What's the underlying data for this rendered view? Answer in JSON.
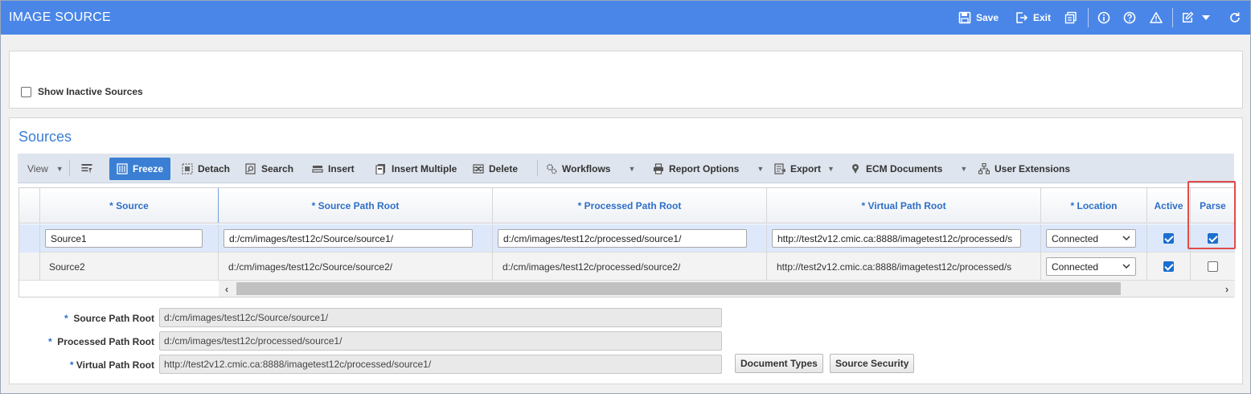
{
  "window": {
    "title": "IMAGE SOURCE"
  },
  "header_actions": {
    "save": "Save",
    "exit": "Exit"
  },
  "filters": {
    "show_inactive_label": "Show Inactive Sources",
    "show_inactive_checked": false
  },
  "section": {
    "title": "Sources"
  },
  "toolbar": {
    "view": "View",
    "freeze": "Freeze",
    "detach": "Detach",
    "search": "Search",
    "insert": "Insert",
    "insert_multiple": "Insert Multiple",
    "delete": "Delete",
    "workflows": "Workflows",
    "report_options": "Report Options",
    "export": "Export",
    "ecm_documents": "ECM Documents",
    "user_extensions": "User Extensions"
  },
  "grid": {
    "columns": [
      "* Source",
      "* Source Path Root",
      "*  Processed Path Root",
      "* Virtual Path Root",
      "* Location",
      "Active",
      "Parse"
    ],
    "rows": [
      {
        "source": "Source1",
        "source_path_root": "d:/cm/images/test12c/Source/source1/",
        "processed_path_root": "d:/cm/images/test12c/processed/source1/",
        "virtual_path_root": "http://test2v12.cmic.ca:8888/imagetest12c/processed/s",
        "location": "Connected",
        "active": true,
        "parse": true
      },
      {
        "source": "Source2",
        "source_path_root": "d:/cm/images/test12c/Source/source2/",
        "processed_path_root": "d:/cm/images/test12c/processed/source2/",
        "virtual_path_root": "http://test2v12.cmic.ca:8888/imagetest12c/processed/s",
        "location": "Connected",
        "active": true,
        "parse": false
      }
    ]
  },
  "detail": {
    "source_path_root_label": "Source Path Root",
    "source_path_root_value": "d:/cm/images/test12c/Source/source1/",
    "processed_path_root_label": "Processed Path Root",
    "processed_path_root_value": "d:/cm/images/test12c/processed/source1/",
    "virtual_path_root_label": "Virtual Path Root",
    "virtual_path_root_value": "http://test2v12.cmic.ca:8888/imagetest12c/processed/source1/",
    "document_types_button": "Document Types",
    "source_security_button": "Source Security"
  },
  "colors": {
    "header_blue": "#4a86e8",
    "accent_blue": "#3a7fd4",
    "highlight_red": "#e14b4b"
  }
}
